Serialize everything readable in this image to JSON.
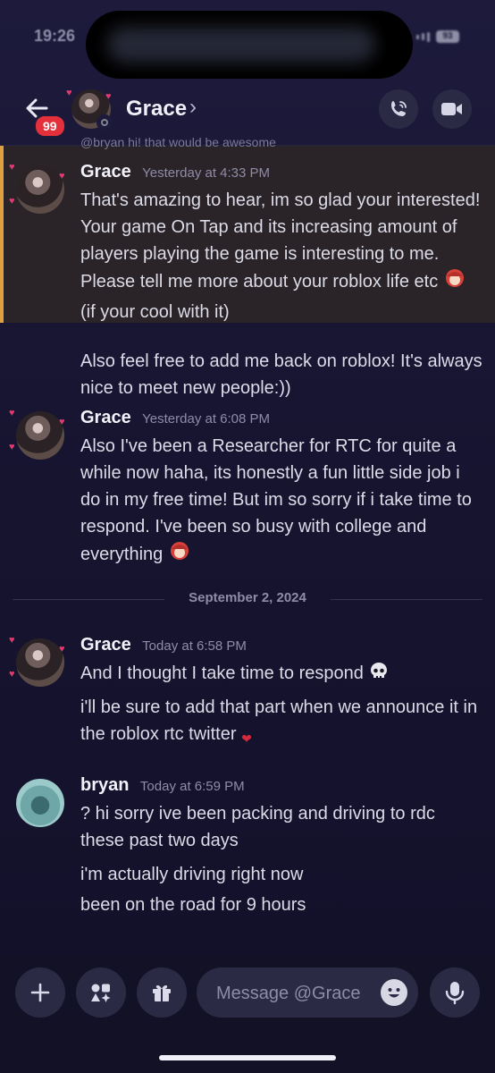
{
  "status_bar": {
    "time": "19:26",
    "battery": "93"
  },
  "header": {
    "back_badge": "99",
    "contact_name": "Grace",
    "chevron": "›",
    "call_icon": "phone-icon",
    "video_icon": "video-camera-icon"
  },
  "chat": {
    "reply_preview": "@bryan  hi! that would be awesome",
    "messages": [
      {
        "author": "Grace",
        "timestamp": "Yesterday at 4:33 PM",
        "lines": [
          "That's amazing to hear, im so glad your interested! Your game On Tap and its increasing amount of players playing the game is interesting to me. Please tell me more about your roblox life etc",
          "(if your cool with it)"
        ],
        "second": "Also feel free to add me back on roblox! It's always nice to meet new people:))"
      },
      {
        "author": "Grace",
        "timestamp": "Yesterday at 6:08 PM",
        "text": "Also I've been a Researcher for RTC for quite a while now haha, its honestly a fun little side job i do in my free time! But im so sorry if i take time to respond. I've been so busy with college and everything"
      },
      {
        "author": "Grace",
        "timestamp": "Today at 6:58 PM",
        "text1": "And I thought I take time to respond",
        "text2": "i'll be sure to add that part when we announce it in the roblox rtc twitter"
      },
      {
        "author": "bryan",
        "timestamp": "Today at 6:59 PM",
        "text1": "? hi sorry ive been packing and driving to rdc these past two days",
        "text2": "i'm actually driving right now",
        "text3": "been on the road for 9 hours"
      }
    ],
    "date_divider": "September 2, 2024"
  },
  "composer": {
    "placeholder": "Message @Grace"
  },
  "colors": {
    "background": "#16142f",
    "highlight": "#2a2328",
    "highlight_border": "#e0a040",
    "badge": "#e3303a"
  }
}
